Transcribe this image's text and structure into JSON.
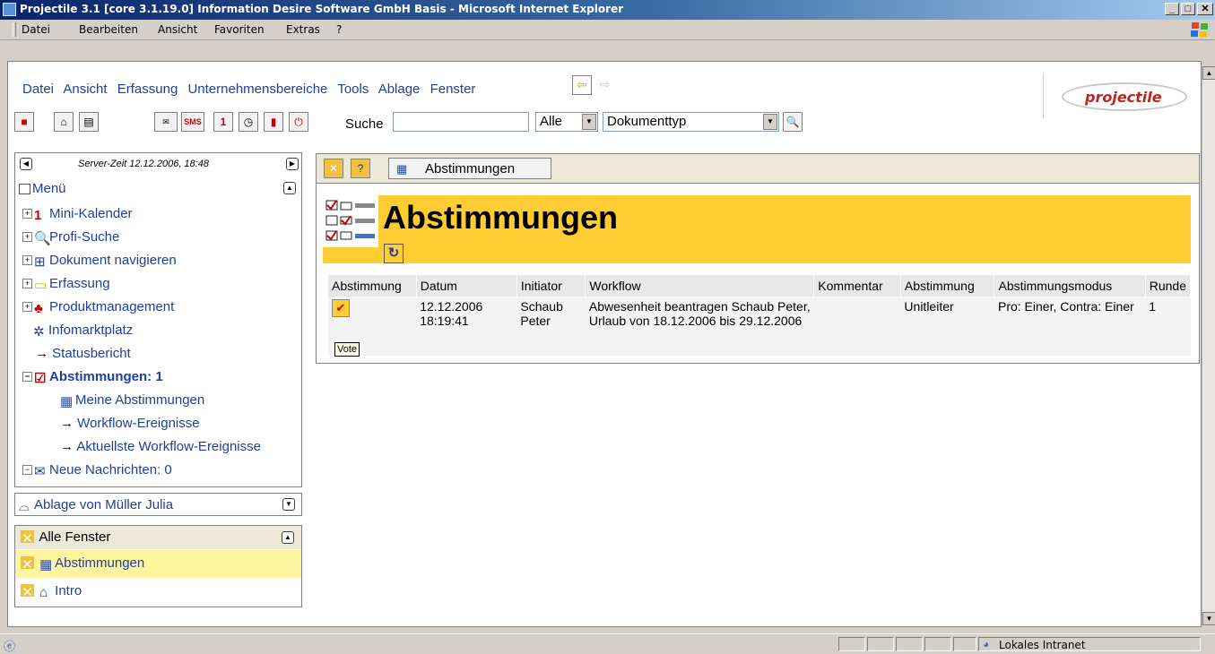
{
  "window": {
    "title": "Projectile 3.1 [core 3.1.19.0] Information Desire Software GmbH Basis - Microsoft Internet Explorer"
  },
  "browser_menu": [
    "Datei",
    "Bearbeiten",
    "Ansicht",
    "Favoriten",
    "Extras",
    "?"
  ],
  "app_menu": [
    "Datei",
    "Ansicht",
    "Erfassung",
    "Unternehmensbereiche",
    "Tools",
    "Ablage",
    "Fenster"
  ],
  "logo": {
    "text": "projectile"
  },
  "toolbar": {
    "sms_label": "SMS",
    "calendar_label": "1",
    "search_label": "Suche",
    "search_value": "",
    "scope_select": "Alle",
    "doctype_select": "Dokumenttyp"
  },
  "left": {
    "server_time": "Server-Zeit 12.12.2006, 18:48",
    "menu_title": "Menü",
    "tree": [
      {
        "label": "Mini-Kalender"
      },
      {
        "label": "Profi-Suche"
      },
      {
        "label": "Dokument navigieren"
      },
      {
        "label": "Erfassung"
      },
      {
        "label": "Produktmanagement"
      },
      {
        "label": "Infomarktplatz"
      },
      {
        "label": "Statusbericht"
      },
      {
        "label": "Abstimmungen: 1"
      },
      {
        "label": "Meine Abstimmungen"
      },
      {
        "label": "Workflow-Ereignisse"
      },
      {
        "label": "Aktuellste Workflow-Ereignisse"
      },
      {
        "label": "Neue Nachrichten: 0"
      }
    ],
    "ablage_title": "Ablage von Müller Julia",
    "fenster_title": "Alle Fenster",
    "fenster_items": [
      "Abstimmungen",
      "Intro"
    ]
  },
  "right": {
    "tab_label": "Abstimmungen",
    "banner_title": "Abstimmungen",
    "table": {
      "headers": [
        "Abstimmung",
        "Datum",
        "Initiator",
        "Workflow",
        "Kommentar",
        "Abstimmung",
        "Abstimmungsmodus",
        "Runde"
      ],
      "rows": [
        {
          "datum": "12.12.2006 18:19:41",
          "initiator": "Schaub Peter",
          "workflow": "Abwesenheit beantragen Schaub Peter, Urlaub von 18.12.2006 bis 29.12.2006",
          "kommentar": "",
          "abstimmung": "Unitleiter",
          "modus": "Pro: Einer, Contra: Einer",
          "runde": "1"
        }
      ]
    },
    "tooltip": "Vote"
  },
  "statusbar": {
    "zone": "Lokales Intranet"
  },
  "colors": {
    "banner": "#fecc33",
    "link": "#1f3f9c",
    "highlight": "#fff5a0"
  }
}
